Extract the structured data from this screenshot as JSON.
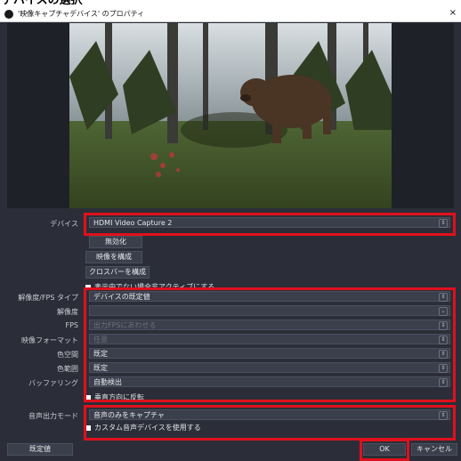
{
  "caption": "デバイスの選択",
  "window": {
    "title": "'映像キャプチャデバイス' のプロパティ",
    "close": "×"
  },
  "device": {
    "label": "デバイス",
    "value": "HDMI Video Capture 2"
  },
  "buttons": {
    "deactivate": "無効化",
    "configure_video": "映像を構成",
    "configure_crossbar": "クロスバーを構成",
    "defaults": "既定値",
    "ok": "OK",
    "cancel": "キャンセル"
  },
  "checkboxes": {
    "deactivate_hidden": "表示中でない場合非アクティブにする",
    "flip_vertical": "垂直方向に反転",
    "custom_audio": "カスタム音声デバイスを使用する"
  },
  "fields": [
    {
      "label": "解像度/FPS タイプ",
      "value": "デバイスの既定値",
      "disabled": false
    },
    {
      "label": "解像度",
      "value": "",
      "disabled": false
    },
    {
      "label": "FPS",
      "value": "出力FPSにあわせる",
      "disabled": true
    },
    {
      "label": "映像フォーマット",
      "value": "任意",
      "disabled": true
    },
    {
      "label": "色空間",
      "value": "既定",
      "disabled": false
    },
    {
      "label": "色範囲",
      "value": "既定",
      "disabled": false
    },
    {
      "label": "バッファリング",
      "value": "自動検出",
      "disabled": false
    }
  ],
  "audio": {
    "label": "音声出力モード",
    "value": "音声のみをキャプチャ"
  }
}
